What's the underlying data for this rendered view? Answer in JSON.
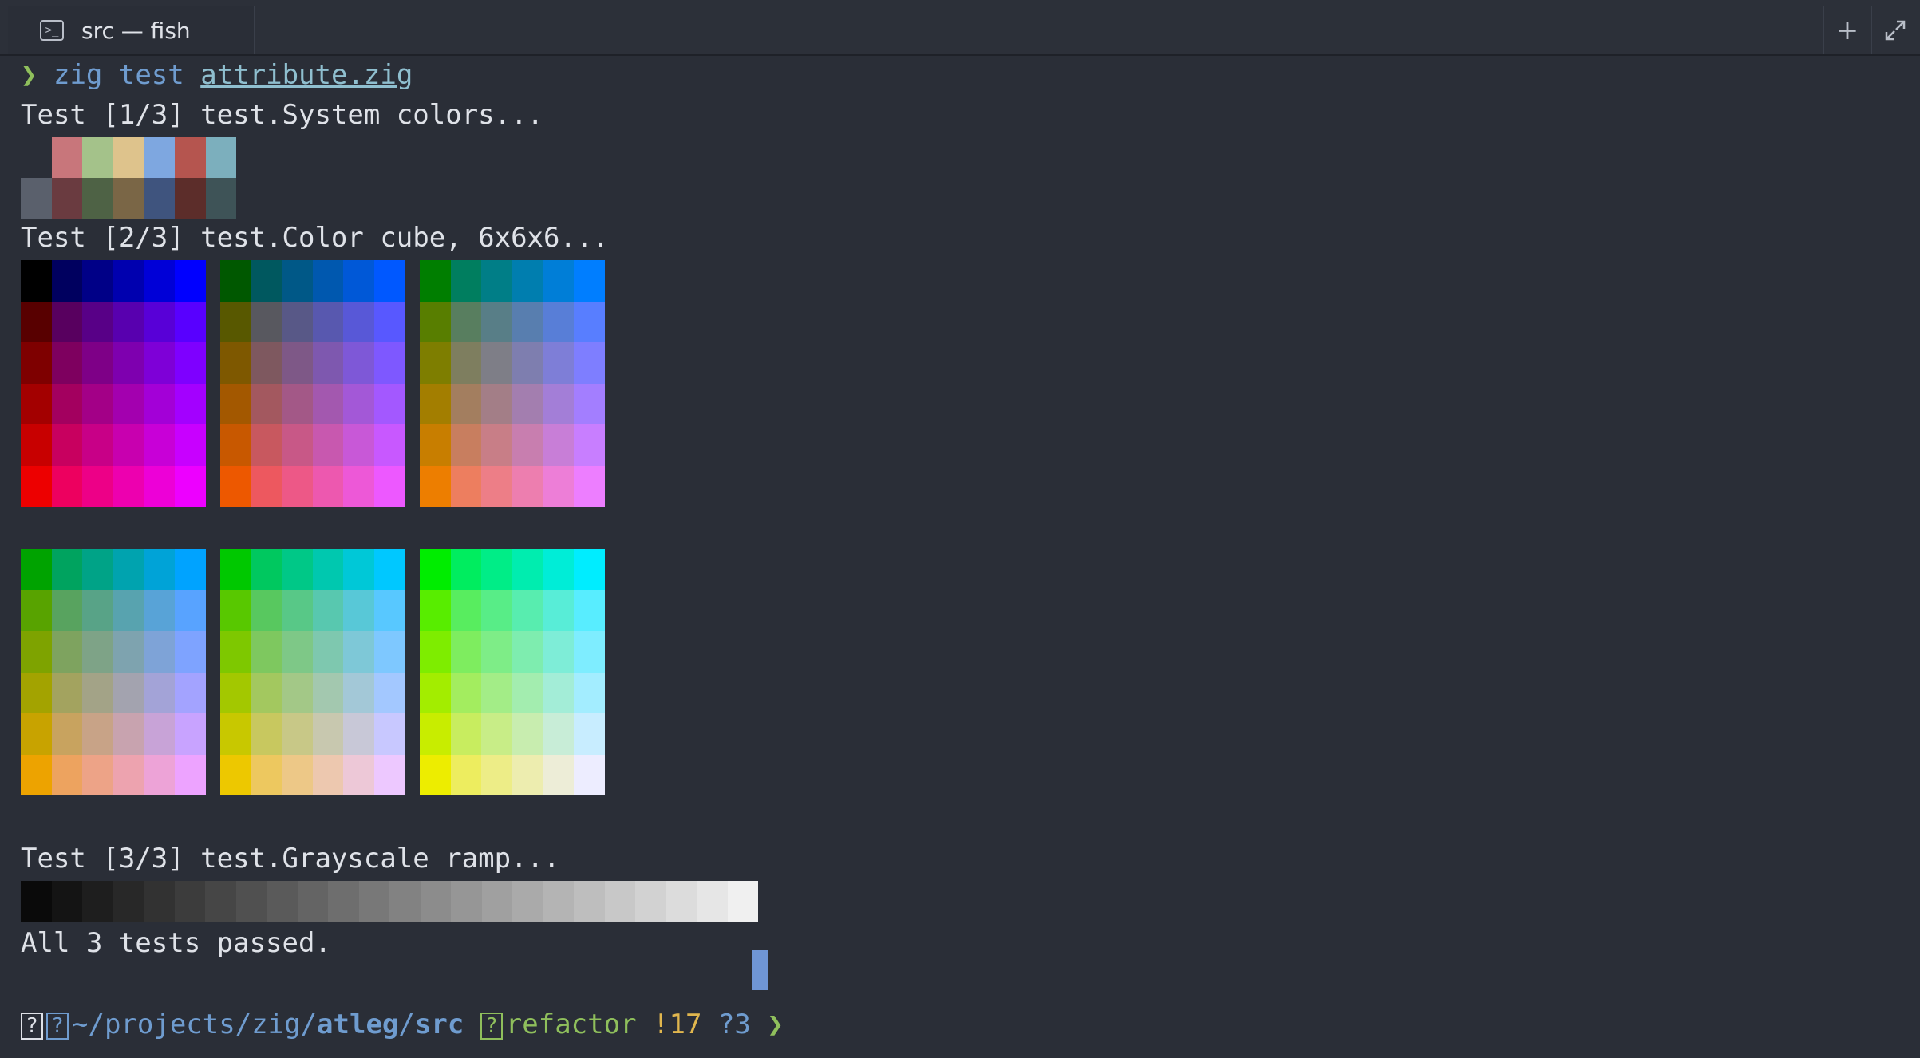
{
  "window": {
    "tab_title": "src — fish",
    "tab_icon": "terminal-icon"
  },
  "toolbar": {
    "new_tab_label": "+",
    "fullscreen_icon": "expand-icon"
  },
  "terminal": {
    "prompt_symbol": "❯",
    "command": "zig test",
    "command_arg": "attribute.zig",
    "test1": "Test [1/3] test.System colors...",
    "test2": "Test [2/3] test.Color cube, 6x6x6...",
    "test3": "Test [3/3] test.Grayscale ramp...",
    "result": "All 3 tests passed.",
    "system_colors_top": [
      "#2a2e37",
      "#c8767b",
      "#a4c28a",
      "#dec38c",
      "#7ea7e0",
      "#b5554f",
      "#7cafbd"
    ],
    "system_colors_bottom": [
      "#5a606c",
      "#6a3b40",
      "#4e6245",
      "#7a6646",
      "#3f547e",
      "#5c2d2a",
      "#3e5357"
    ],
    "grayscale": [
      "#0a0a0a",
      "#141414",
      "#1e1e1e",
      "#282828",
      "#323232",
      "#3c3c3c",
      "#464646",
      "#505050",
      "#5a5a5a",
      "#646464",
      "#6e6e6e",
      "#787878",
      "#828282",
      "#8c8c8c",
      "#969696",
      "#a0a0a0",
      "#aaaaaa",
      "#b4b4b4",
      "#bebebe",
      "#c8c8c8",
      "#d2d2d2",
      "#dcdcdc",
      "#e6e6e6",
      "#f0f0f0"
    ],
    "prompt_line": {
      "path_prefix": "~/projects/zig/",
      "path_bold": "atleg",
      "path_sep": "/",
      "path_end": "src",
      "branch": "refactor",
      "modified": "!17",
      "untracked": "?3",
      "arrow": "❯",
      "box_char": "?"
    }
  }
}
